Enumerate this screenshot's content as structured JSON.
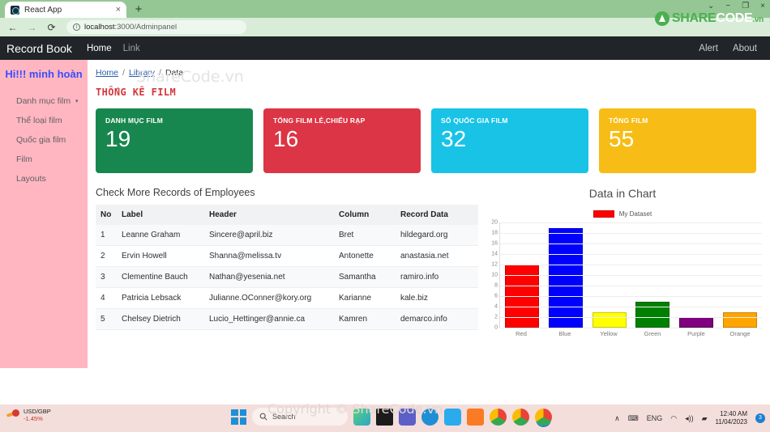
{
  "browser": {
    "tab_title": "React App",
    "tab_close": "×",
    "new_tab": "+",
    "back": "←",
    "forward": "→",
    "reload": "⟳",
    "url_host": "localhost",
    "url_path": ":3000/Adminpanel",
    "minimize": "−",
    "maximize": "❐",
    "close": "×",
    "chevron": "⌄"
  },
  "watermark": {
    "logo_share": "SHARE",
    "logo_code": "CODE",
    "logo_vn": ".vn",
    "inline": "ShareCode.vn",
    "taskbar": "Copyright © ShareCode.vn"
  },
  "navbar": {
    "brand": "Record Book",
    "links": [
      {
        "label": "Home",
        "muted": false
      },
      {
        "label": "Link",
        "muted": true
      }
    ],
    "right_links": [
      {
        "label": "Alert"
      },
      {
        "label": "About"
      }
    ]
  },
  "sidebar": {
    "greeting": "Hi!!! minh hoàn",
    "items": [
      {
        "label": "Danh mục film",
        "has_caret": true
      },
      {
        "label": "Thể loại film",
        "has_caret": false
      },
      {
        "label": "Quốc gia film",
        "has_caret": false
      },
      {
        "label": "Film",
        "has_caret": false
      },
      {
        "label": "Layouts",
        "has_caret": false
      }
    ],
    "caret": "▾"
  },
  "breadcrumb": {
    "items": [
      "Home",
      "Library",
      "Data"
    ],
    "separator": "/"
  },
  "page": {
    "title": "THỐNG KÊ FILM"
  },
  "cards": [
    {
      "label": "DANH MỤC FILM",
      "value": "19",
      "color": "#18874f"
    },
    {
      "label": "TỔNG FILM LẺ,CHIẾU RẠP",
      "value": "16",
      "color": "#dc3545"
    },
    {
      "label": "SỐ QUỐC GIA FILM",
      "value": "32",
      "color": "#19c3e6"
    },
    {
      "label": "TỔNG FILM",
      "value": "55",
      "color": "#f7bd16"
    }
  ],
  "table": {
    "title": "Check More Records of Employees",
    "columns": [
      "No",
      "Label",
      "Header",
      "Column",
      "Record Data"
    ],
    "rows": [
      [
        "1",
        "Leanne Graham",
        "Sincere@april.biz",
        "Bret",
        "hildegard.org"
      ],
      [
        "2",
        "Ervin Howell",
        "Shanna@melissa.tv",
        "Antonette",
        "anastasia.net"
      ],
      [
        "3",
        "Clementine Bauch",
        "Nathan@yesenia.net",
        "Samantha",
        "ramiro.info"
      ],
      [
        "4",
        "Patricia Lebsack",
        "Julianne.OConner@kory.org",
        "Karianne",
        "kale.biz"
      ],
      [
        "5",
        "Chelsey Dietrich",
        "Lucio_Hettinger@annie.ca",
        "Kamren",
        "demarco.info"
      ]
    ]
  },
  "chart_data": {
    "type": "bar",
    "title": "Data in Chart",
    "xlabel": "",
    "ylabel": "",
    "ylim": [
      0,
      20
    ],
    "yticks": [
      0,
      2,
      4,
      6,
      8,
      10,
      12,
      14,
      16,
      18,
      20
    ],
    "grid": true,
    "legend": {
      "position": "top",
      "entries": [
        "My Dataset"
      ]
    },
    "categories": [
      "Red",
      "Blue",
      "Yellow",
      "Green",
      "Purple",
      "Orange"
    ],
    "values": [
      12,
      19,
      3,
      5,
      2,
      3
    ],
    "colors": [
      "#ff0000",
      "#0000ff",
      "#ffff00",
      "#008000",
      "#800080",
      "#ffa500"
    ],
    "border_colors": [
      "#cc0000",
      "#0000cc",
      "#cccc00",
      "#006400",
      "#4b004b",
      "#cc8400"
    ],
    "series": [
      {
        "name": "My Dataset",
        "values": [
          12,
          19,
          3,
          5,
          2,
          3
        ]
      }
    ]
  },
  "taskbar": {
    "widget_title": "USD/GBP",
    "widget_change": "-1.45%",
    "search_placeholder": "Search",
    "lang": "ENG",
    "time": "12:40 AM",
    "date": "11/04/2023",
    "badge": "3",
    "chevron_up": "∧",
    "keyboard": "⌨",
    "wifi": "◠",
    "volume": "◂))",
    "battery": "▰"
  }
}
